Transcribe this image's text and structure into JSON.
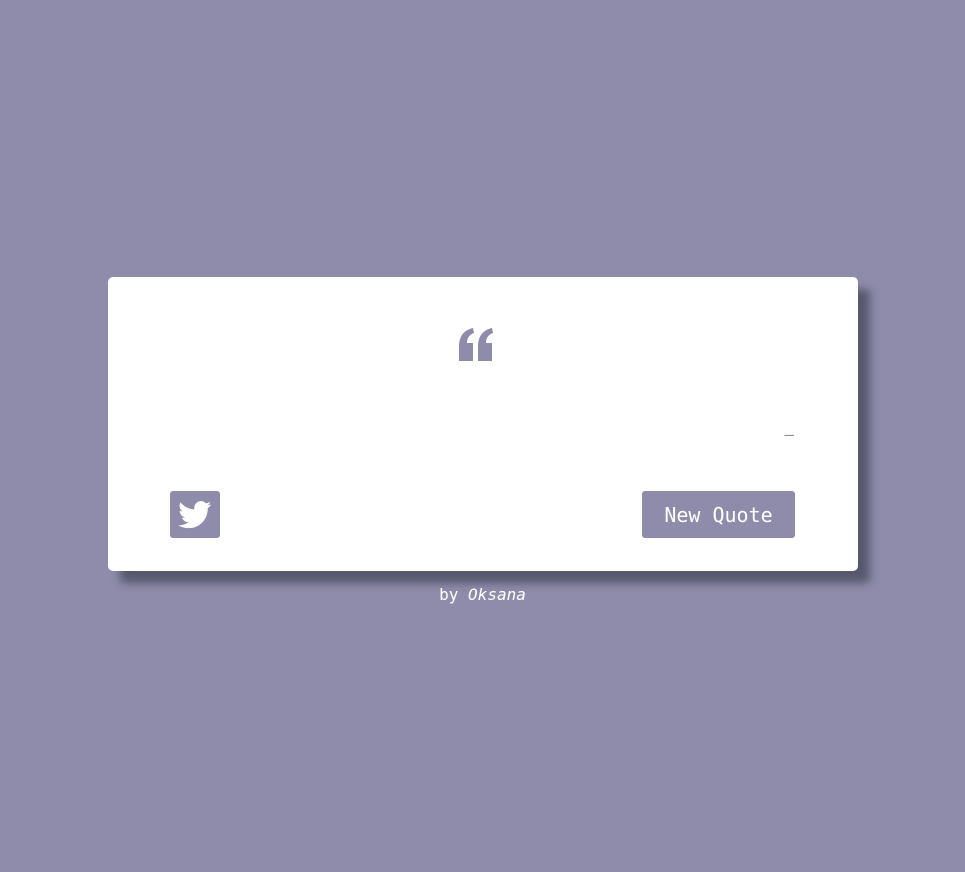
{
  "theme": {
    "background": "#8f8cab",
    "card": "#ffffff",
    "accent": "#8f8cab",
    "button_text": "#ffffff"
  },
  "quote": {
    "icon": "quote-left-icon",
    "text": "",
    "author_prefix": "–",
    "author": ""
  },
  "actions": {
    "tweet_icon": "twitter-icon",
    "new_quote_label": "New Quote"
  },
  "footer": {
    "by_label": "by",
    "author_name": "Oksana"
  }
}
